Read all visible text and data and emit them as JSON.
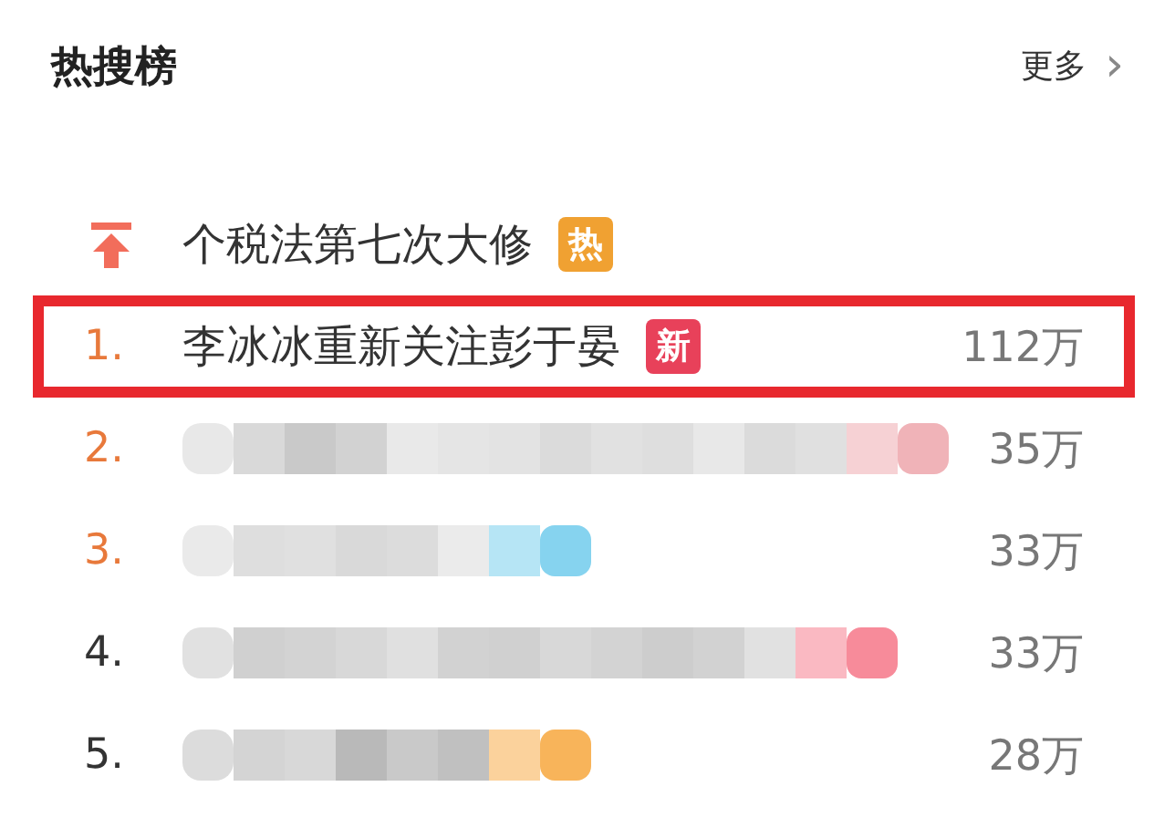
{
  "header": {
    "title": "热搜榜",
    "more": "更多",
    "more_arrow": "›"
  },
  "rows": [
    {
      "kind": "pinned",
      "title": "个税法第七次大修",
      "badge": {
        "text": "热",
        "color": "#f0a132"
      },
      "marked": false
    },
    {
      "kind": "ranked",
      "rank": "1.",
      "accent": true,
      "title": "李冰冰重新关注彭于晏",
      "badge": {
        "text": "新",
        "color": "#e8415a"
      },
      "count": "112万",
      "marked": true
    },
    {
      "kind": "blurred",
      "rank": "2.",
      "accent": true,
      "color": "#f0b3b8",
      "count": "35万",
      "marked": false
    },
    {
      "kind": "blurred",
      "rank": "3.",
      "accent": true,
      "color": "#86d3ef",
      "count": "33万",
      "marked": false
    },
    {
      "kind": "blurred",
      "rank": "4.",
      "accent": false,
      "color": "#f78b9a",
      "count": "33万",
      "marked": false
    },
    {
      "kind": "blurred",
      "rank": "5.",
      "accent": false,
      "color": "#f8b45a",
      "count": "28万",
      "marked": false
    }
  ]
}
